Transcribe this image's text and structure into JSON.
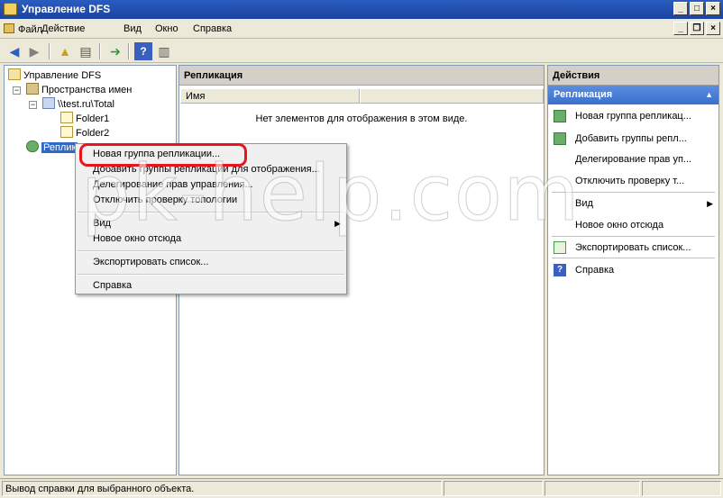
{
  "window": {
    "title": "Управление DFS"
  },
  "menubar": {
    "items": [
      "Файл",
      "Действие",
      "Вид",
      "Окно",
      "Справка"
    ]
  },
  "toolbar": {
    "icons": [
      "back-icon",
      "forward-icon",
      "up-folder-icon",
      "show-tree-icon",
      "export-icon",
      "help-icon",
      "show-actions-icon"
    ]
  },
  "tree": {
    "root": "Управление DFS",
    "namespaces": "Пространства имен",
    "namespace_root": "\\\\test.ru\\Total",
    "folder1": "Folder1",
    "folder2": "Folder2",
    "replication": "Реплик"
  },
  "center": {
    "header": "Репликация",
    "column_name": "Имя",
    "empty_message": "Нет элементов для отображения в этом виде."
  },
  "actions": {
    "header": "Действия",
    "section": "Репликация",
    "items": [
      "Новая группа репликац...",
      "Добавить группы репл...",
      "Делегирование прав уп...",
      "Отключить проверку т...",
      "Вид",
      "Новое окно отсюда",
      "Экспортировать список...",
      "Справка"
    ]
  },
  "context_menu": {
    "items": [
      "Новая группа репликации...",
      "Добавить группы репликации для отображения...",
      "Делегирование прав управления...",
      "Отключить проверку топологии",
      "Вид",
      "Новое окно отсюда",
      "Экспортировать список...",
      "Справка"
    ]
  },
  "statusbar": {
    "text": "Вывод справки для выбранного объекта."
  },
  "watermark": "pk-help.com",
  "colors": {
    "titlebar": "#1c43a0",
    "selection": "#316ac5",
    "highlight_ring": "#e8141e",
    "action_section": "#3c6fcc"
  }
}
